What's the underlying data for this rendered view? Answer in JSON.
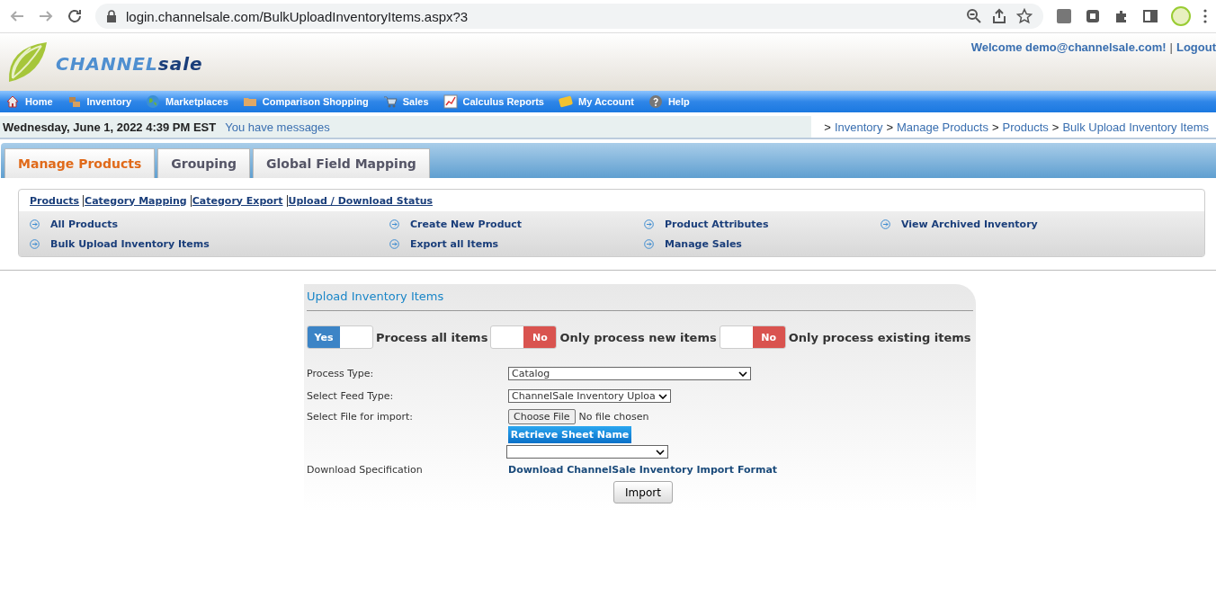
{
  "browser": {
    "url": "login.channelsale.com/BulkUploadInventoryItems.aspx?3"
  },
  "header": {
    "logo_part_1": "CHANNEL",
    "logo_part_2": "sale",
    "welcome": "Welcome demo@channelsale.com!",
    "separator": "|",
    "logout": "Logout"
  },
  "nav": [
    {
      "label": "Home"
    },
    {
      "label": "Inventory"
    },
    {
      "label": "Marketplaces"
    },
    {
      "label": "Comparison Shopping"
    },
    {
      "label": "Sales"
    },
    {
      "label": "Calculus Reports"
    },
    {
      "label": "My Account"
    },
    {
      "label": "Help"
    }
  ],
  "info_bar": {
    "date": "Wednesday, June 1, 2022 4:39 PM EST",
    "messages": "You have messages",
    "breadcrumb": [
      ">",
      "Inventory",
      ">",
      "Manage Products",
      ">",
      "Products",
      ">",
      "Bulk Upload Inventory Items"
    ]
  },
  "tabs": [
    {
      "label": "Manage Products",
      "selected": true
    },
    {
      "label": "Grouping",
      "selected": false
    },
    {
      "label": "Global Field Mapping",
      "selected": false
    }
  ],
  "submenu": {
    "links": [
      "Products",
      "Category Mapping",
      "Category Export",
      "Upload / Download Status"
    ],
    "items": [
      {
        "label": "All Products"
      },
      {
        "label": "Create New Product"
      },
      {
        "label": "Product Attributes"
      },
      {
        "label": "View Archived Inventory"
      },
      {
        "label": "Bulk Upload Inventory Items"
      },
      {
        "label": "Export all Items"
      },
      {
        "label": "Manage Sales"
      }
    ]
  },
  "form": {
    "title": "Upload Inventory Items",
    "toggles": [
      {
        "label": "Process all items",
        "on": true,
        "on_text": "Yes"
      },
      {
        "label": "Only process new items",
        "on": false,
        "off_text": "No"
      },
      {
        "label": "Only process existing items",
        "on": false,
        "off_text": "No"
      }
    ],
    "process_type": {
      "label": "Process Type:",
      "value": "Catalog"
    },
    "feed_type": {
      "label": "Select Feed Type:",
      "value": "ChannelSale Inventory Uploa"
    },
    "file": {
      "label": "Select File for import:",
      "button": "Choose File",
      "status": "No file chosen"
    },
    "retrieve_button": "Retrieve Sheet Name",
    "download": {
      "label": "Download Specification",
      "link": "Download ChannelSale Inventory Import Format"
    },
    "import_button": "Import"
  }
}
